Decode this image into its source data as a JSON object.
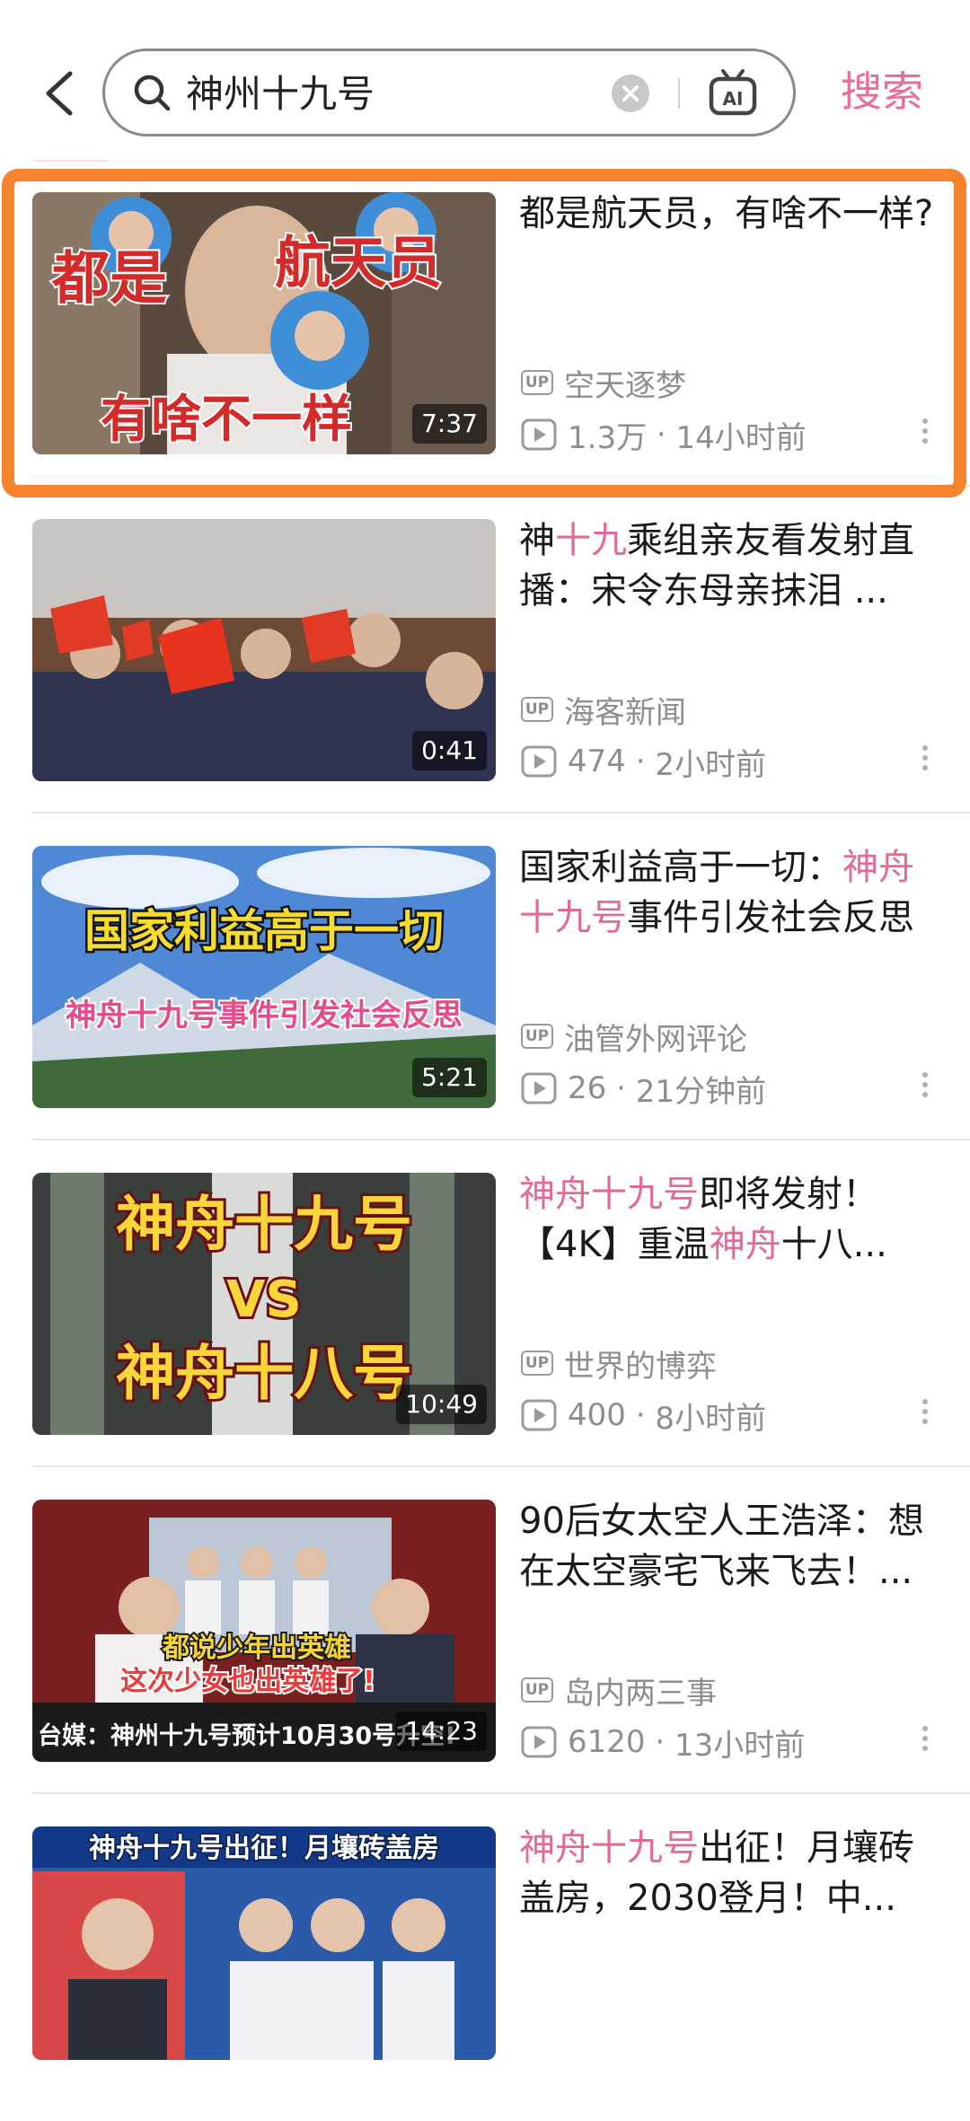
{
  "search": {
    "query": "神州十九号",
    "submit_label": "搜索",
    "ai_label": "AI"
  },
  "results": [
    {
      "title_parts": [
        {
          "t": "都是航天员，有啥不一样?",
          "hl": false
        }
      ],
      "uploader": "空天逐梦",
      "views": "1.3万",
      "time": "14小时前",
      "duration": "7:37",
      "thumb_text": [
        "都是",
        "航天员",
        "有啥不一样"
      ]
    },
    {
      "title_parts": [
        {
          "t": "神",
          "hl": false
        },
        {
          "t": "十九",
          "hl": true
        },
        {
          "t": "乘组亲友看发射直播：宋令东母亲抹泪 ...",
          "hl": false
        }
      ],
      "uploader": "海客新闻",
      "views": "474",
      "time": "2小时前",
      "duration": "0:41",
      "thumb_text": []
    },
    {
      "title_parts": [
        {
          "t": "国家利益高于一切：",
          "hl": false
        },
        {
          "t": "神舟十九号",
          "hl": true
        },
        {
          "t": "事件引发社会反思",
          "hl": false
        }
      ],
      "uploader": "油管外网评论",
      "views": "26",
      "time": "21分钟前",
      "duration": "5:21",
      "thumb_text": [
        "国家利益高于一切",
        "神舟十九号事件引发社会反思"
      ]
    },
    {
      "title_parts": [
        {
          "t": "神舟十九号",
          "hl": true
        },
        {
          "t": "即将发射！【4K】重温",
          "hl": false
        },
        {
          "t": "神舟",
          "hl": true
        },
        {
          "t": "十八...",
          "hl": false
        }
      ],
      "uploader": "世界的博弈",
      "views": "400",
      "time": "8小时前",
      "duration": "10:49",
      "thumb_text": [
        "神舟十九号",
        "VS",
        "神舟十八号"
      ]
    },
    {
      "title_parts": [
        {
          "t": "90后女太空人王浩泽：想在太空豪宅飞来飞去！...",
          "hl": false
        }
      ],
      "uploader": "岛内两三事",
      "views": "6120",
      "time": "13小时前",
      "duration": "14:23",
      "thumb_text": [
        "都说少年出英雄",
        "这次少女也出英雄了!",
        "台媒：神州十九号预计10月30号升空!"
      ]
    },
    {
      "title_parts": [
        {
          "t": "神舟十九号",
          "hl": true
        },
        {
          "t": "出征！月壤砖盖房，2030登月！中...",
          "hl": false
        }
      ],
      "uploader": "",
      "views": "",
      "time": "",
      "duration": "",
      "thumb_text": [
        "神舟十九号出征！月壤砖盖房"
      ]
    }
  ],
  "colors": {
    "accent": "#ea6c9a",
    "highlight": "#e26a98",
    "selection_border": "#f5832e",
    "meta": "#8e8e8e"
  }
}
